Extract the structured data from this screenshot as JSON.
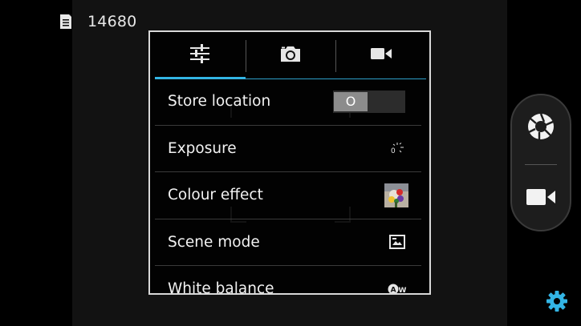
{
  "status": {
    "remaining_photos": "14680",
    "storage_icon": "sd-card-icon"
  },
  "settings_menu": {
    "tabs": [
      {
        "icon": "sliders-icon",
        "active": true
      },
      {
        "icon": "camera-icon",
        "active": false
      },
      {
        "icon": "video-camera-icon",
        "active": false
      }
    ],
    "rows": [
      {
        "label": "Store location",
        "control": "toggle",
        "toggle_text": "O",
        "toggle_state": "off"
      },
      {
        "label": "Exposure",
        "control": "icon",
        "icon": "exposure-icon",
        "icon_text": "0"
      },
      {
        "label": "Colour effect",
        "control": "icon",
        "icon": "colour-effect-thumbnail"
      },
      {
        "label": "Scene mode",
        "control": "icon",
        "icon": "scene-mode-icon"
      },
      {
        "label": "White balance",
        "control": "icon",
        "icon": "white-balance-auto-icon",
        "icon_text": "AW"
      }
    ]
  },
  "controls": {
    "shutter_icon": "shutter-icon",
    "video_icon": "video-camera-icon",
    "settings_icon": "gear-icon"
  },
  "colors": {
    "accent": "#33b5e5",
    "gear": "#33b5e5",
    "background": "#000000"
  }
}
